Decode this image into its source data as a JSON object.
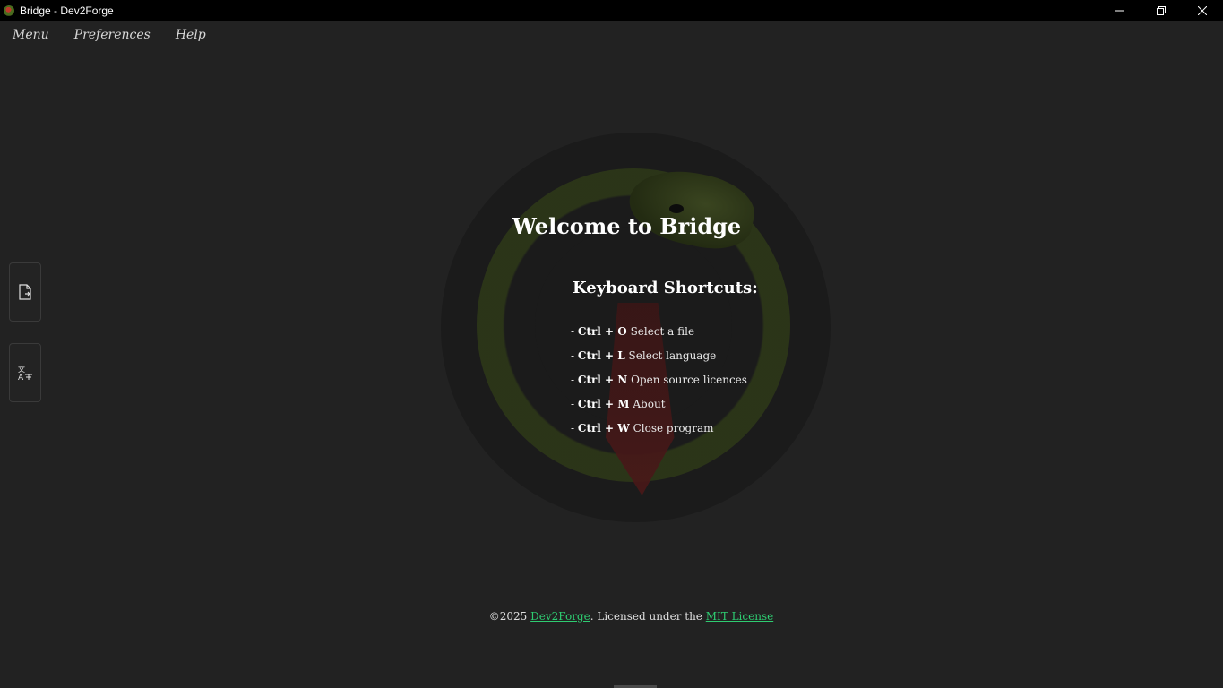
{
  "window": {
    "title": "Bridge - Dev2Forge",
    "controls": {
      "minimize": "—",
      "restore": "❐",
      "close": "✕"
    }
  },
  "menubar": {
    "items": [
      {
        "label": "Menu"
      },
      {
        "label": "Preferences"
      },
      {
        "label": "Help"
      }
    ]
  },
  "sidebar": {
    "buttons": [
      {
        "icon": "file-import-icon"
      },
      {
        "icon": "language-translate-icon"
      }
    ]
  },
  "main": {
    "welcome": "Welcome to Bridge",
    "shortcuts_title": "Keyboard Shortcuts:",
    "shortcuts": [
      {
        "prefix": "-",
        "keys": "Ctrl + O",
        "action": "Select a file"
      },
      {
        "prefix": "-",
        "keys": "Ctrl + L",
        "action": "Select language"
      },
      {
        "prefix": "-",
        "keys": "Ctrl + N",
        "action": "Open source licences"
      },
      {
        "prefix": "-",
        "keys": "Ctrl + M",
        "action": "About"
      },
      {
        "prefix": "-",
        "keys": "Ctrl + W",
        "action": "Close program"
      }
    ]
  },
  "footer": {
    "copyright": "©2025",
    "org_link": "Dev2Forge",
    "licensed_text": ". Licensed under the",
    "license_link": "MIT License"
  },
  "colors": {
    "background": "#222222",
    "link": "#2ecc71",
    "titlebar": "#000000"
  }
}
